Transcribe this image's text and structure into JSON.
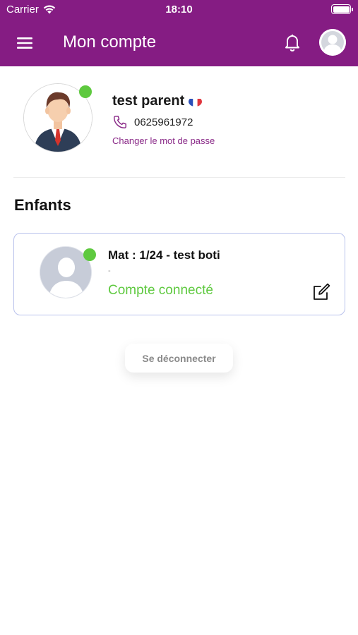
{
  "status_bar": {
    "carrier": "Carrier",
    "time": "18:10",
    "wifi_icon": "wifi-icon",
    "battery_icon": "battery-icon"
  },
  "header": {
    "title": "Mon compte",
    "menu_icon": "hamburger-menu-icon",
    "bell_icon": "bell-icon",
    "avatar_icon": "user-avatar-icon",
    "background_color": "#851c83"
  },
  "profile": {
    "name": "test parent",
    "flag_icon": "france-flag-icon",
    "phone": "0625961972",
    "phone_icon": "phone-icon",
    "change_password_label": "Changer le mot de passe",
    "online": true
  },
  "children_section": {
    "title": "Enfants",
    "children": [
      {
        "name": "Mat : 1/24 - test boti",
        "subtitle": "-",
        "status": "Compte connecté",
        "status_color": "#5ec93f",
        "online": true,
        "edit_icon": "edit-icon"
      }
    ]
  },
  "logout_label": "Se déconnecter"
}
